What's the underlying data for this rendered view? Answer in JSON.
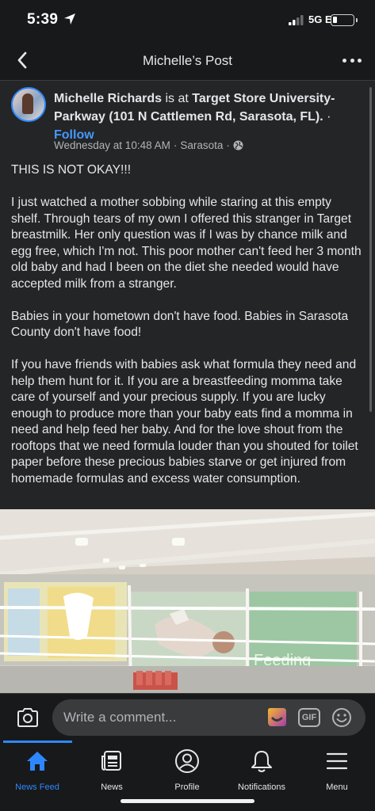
{
  "status_bar": {
    "time": "5:39",
    "network": "5G E",
    "battery_percent": 20
  },
  "header": {
    "title": "Michelle’s Post"
  },
  "post": {
    "author": "Michelle Richards",
    "at_text": " is at ",
    "place": "Target Store University-Parkway (101 N Cattlemen Rd, Sarasota, FL).",
    "separator": " · ",
    "follow": "Follow",
    "timestamp": "Wednesday at 10:48 AM",
    "location": "Sarasota",
    "dot": "·",
    "paragraphs": [
      "THIS IS NOT OKAY!!!",
      "I just watched a mother sobbing while staring at this empty shelf. Through tears of my own I offered this stranger in Target breastmilk. Her only question was if I was by chance milk and egg free, which I'm not. This poor mother can't feed her 3 month old baby and had I been on the diet she needed would have accepted milk from a stranger.",
      "Babies in your hometown don't have food. Babies in Sarasota County don't have food!",
      "If you have friends with babies ask what formula they need and help them hunt for it. If you are a breastfeeding momma take care of yourself and your precious supply. If you are lucky enough to produce more than your baby eats find a momma in need and help feed her baby. And for the love shout from the rooftops that we need formula louder than you shouted for toilet paper before these precious babies starve or get injured from homemade formulas and excess water consumption."
    ],
    "photo_sign_text": "Feeding"
  },
  "comment_bar": {
    "placeholder": "Write a comment...",
    "gif_label": "GIF"
  },
  "tabs": [
    {
      "label": "News Feed",
      "icon": "home-icon",
      "active": true
    },
    {
      "label": "News",
      "icon": "news-icon",
      "active": false
    },
    {
      "label": "Profile",
      "icon": "profile-icon",
      "active": false
    },
    {
      "label": "Notifications",
      "icon": "bell-icon",
      "active": false
    },
    {
      "label": "Menu",
      "icon": "menu-icon",
      "active": false
    }
  ],
  "colors": {
    "background": "#242526",
    "bar": "#18191a",
    "accent": "#2d88ff",
    "link": "#4599ff",
    "text": "#e4e6eb",
    "muted": "#b0b3b8"
  }
}
